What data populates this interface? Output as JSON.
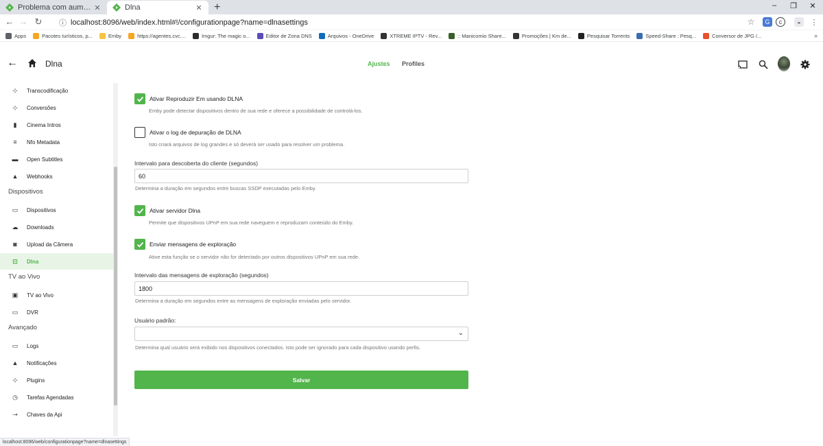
{
  "browser": {
    "tabs": [
      {
        "title": "Problema com aumento de mem",
        "active": false
      },
      {
        "title": "Dlna",
        "active": true
      }
    ],
    "new_tab": "+",
    "window_controls": {
      "minimize": "–",
      "restore": "❐",
      "close": "✕"
    },
    "url": "localhost:8096/web/index.html#!/configurationpage?name=dlnasettings",
    "bookmarks": [
      {
        "label": "Apps",
        "icon": "apps-grid-icon",
        "color": "#5f6368"
      },
      {
        "label": "Pacotes turísticos, p...",
        "icon": "cvc-icon",
        "color": "#f5a623"
      },
      {
        "label": "Emby",
        "icon": "folder-icon",
        "color": "#f6c445"
      },
      {
        "label": "https://agentes.cvc....",
        "icon": "cvc-icon",
        "color": "#f5a623"
      },
      {
        "label": "Imgur: The magic o...",
        "icon": "imgur-icon",
        "color": "#2b2b2b"
      },
      {
        "label": "Editor de Zona DNS",
        "icon": "h-icon",
        "color": "#5b4bb7"
      },
      {
        "label": "Arquivos - OneDrive",
        "icon": "cloud-icon",
        "color": "#0f6cbd"
      },
      {
        "label": "XTREME IPTV - Rev...",
        "icon": "globe-icon",
        "color": "#333333"
      },
      {
        "label": ":: Manicomio Share...",
        "icon": "forum-icon",
        "color": "#3a5f2a"
      },
      {
        "label": "Promoções | Km de...",
        "icon": "globe-icon",
        "color": "#333333"
      },
      {
        "label": "Pesquisar Torrents",
        "icon": "torrent-icon",
        "color": "#222222"
      },
      {
        "label": "Speed-Share : Pesq...",
        "icon": "share-icon",
        "color": "#3c6db0"
      },
      {
        "label": "Conversor de JPG /...",
        "icon": "converter-icon",
        "color": "#e8502f"
      }
    ],
    "status_url": "localhost:8096/web/configurationpage?name=dlnasettings"
  },
  "header": {
    "title": "Dlna",
    "tabs": [
      {
        "label": "Ajustes",
        "selected": true
      },
      {
        "label": "Profiles",
        "selected": false
      }
    ]
  },
  "sidebar": {
    "top_items": [
      {
        "label": "Transcodificação",
        "icon": "transcode-icon",
        "glyph": "⊹"
      },
      {
        "label": "Conversões",
        "icon": "crop-icon",
        "glyph": "⊹"
      },
      {
        "label": "Cinema Intros",
        "icon": "film-icon",
        "glyph": "▮"
      },
      {
        "label": "Nfo Metadata",
        "icon": "list-icon",
        "glyph": "≡"
      },
      {
        "label": "Open Subtitles",
        "icon": "subtitles-icon",
        "glyph": "▬"
      },
      {
        "label": "Webhooks",
        "icon": "bell-icon",
        "glyph": "▲"
      }
    ],
    "sections": [
      {
        "heading": "Dispositivos",
        "items": [
          {
            "label": "Dispositivos",
            "icon": "devices-icon",
            "glyph": "▭"
          },
          {
            "label": "Downloads",
            "icon": "cloud-download-icon",
            "glyph": "☁"
          },
          {
            "label": "Upload da Câmera",
            "icon": "camera-icon",
            "glyph": "◙"
          },
          {
            "label": "Dlna",
            "icon": "dlna-icon",
            "glyph": "⊡",
            "selected": true
          }
        ]
      },
      {
        "heading": "TV ao Vivo",
        "items": [
          {
            "label": "TV ao Vivo",
            "icon": "live-tv-icon",
            "glyph": "▣"
          },
          {
            "label": "DVR",
            "icon": "dvr-icon",
            "glyph": "▭"
          }
        ]
      },
      {
        "heading": "Avançado",
        "items": [
          {
            "label": "Logs",
            "icon": "folder-open-icon",
            "glyph": "▭"
          },
          {
            "label": "Notificações",
            "icon": "bell-icon",
            "glyph": "▲"
          },
          {
            "label": "Plugins",
            "icon": "plugin-icon",
            "glyph": "⊹"
          },
          {
            "label": "Tarefas Agendadas",
            "icon": "clock-icon",
            "glyph": "◷"
          },
          {
            "label": "Chaves da Api",
            "icon": "key-icon",
            "glyph": "⊸"
          }
        ]
      }
    ]
  },
  "form": {
    "play_to": {
      "label": "Ativar Reproduzir Em usando DLNA",
      "checked": true,
      "help": "Emby pode detectar dispositivos dentro de sua rede e oferece a possibilidade de controlá-los."
    },
    "debug_log": {
      "label": "Ativar o log de depuração de DLNA",
      "checked": false,
      "help": "Isto criará arquivos de log grandes e só deverá ser usado para resolver um problema."
    },
    "discovery_interval": {
      "label": "Intervalo para descoberta do cliente (segundos)",
      "value": "60",
      "help": "Determina a duração em segundos entre buscas SSDP executadas pelo Emby."
    },
    "dlna_server": {
      "label": "Ativar servidor Dlna",
      "checked": true,
      "help": "Permite que dispositivos UPnP em sua rede naveguem e reproduzam conteúdo do Emby."
    },
    "blast_alive": {
      "label": "Enviar mensagens de exploração",
      "checked": true,
      "help": "Ative esta função se o servidor não for detectado por outros dispositivos UPnP em sua rede."
    },
    "blast_interval": {
      "label": "Intervalo das mensagens de exploração (segundos)",
      "value": "1800",
      "help": "Determina a duração em segundos entre as mensagens de exploração enviadas pelo servidor."
    },
    "default_user": {
      "label": "Usuário padrão:",
      "value": "",
      "help": "Determina qual usuário será exibido nos dispositivos conectados. Isto pode ser ignorado para cada dispositivo usando perfis."
    },
    "save_label": "Salvar"
  },
  "colors": {
    "accent": "#52b54b",
    "selected_bg": "#e8f5e6"
  }
}
